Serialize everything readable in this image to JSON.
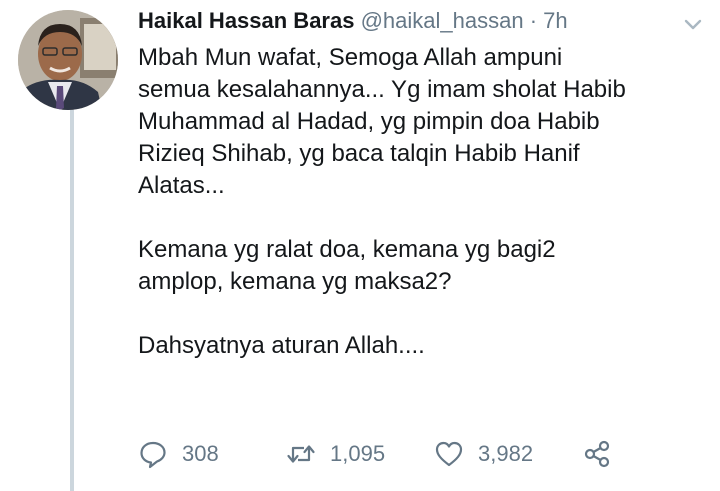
{
  "tweet": {
    "author_name": "Haikal Hassan Baras",
    "author_handle": "@haikal_hassan",
    "separator": "·",
    "time": "7h",
    "paragraphs": [
      "Mbah Mun wafat, Semoga Allah ampuni\nsemua kesalahannya... Yg imam sholat Habib\nMuhammad al Hadad, yg pimpin doa Habib\nRizieq Shihab, yg baca talqin Habib Hanif\nAlatas...",
      "Kemana yg ralat doa, kemana yg bagi2\namplop, kemana yg maksa2?",
      "Dahsyatnya aturan Allah...."
    ],
    "actions": {
      "replies": "308",
      "retweets": "1,095",
      "likes": "3,982"
    }
  },
  "icons": {
    "reply": "reply-icon",
    "retweet": "retweet-icon",
    "like": "heart-icon",
    "share": "share-icon",
    "menu": "chevron-down-icon"
  },
  "colors": {
    "text": "#14171a",
    "secondary": "#657786",
    "thread_line": "#ccd6dd"
  }
}
